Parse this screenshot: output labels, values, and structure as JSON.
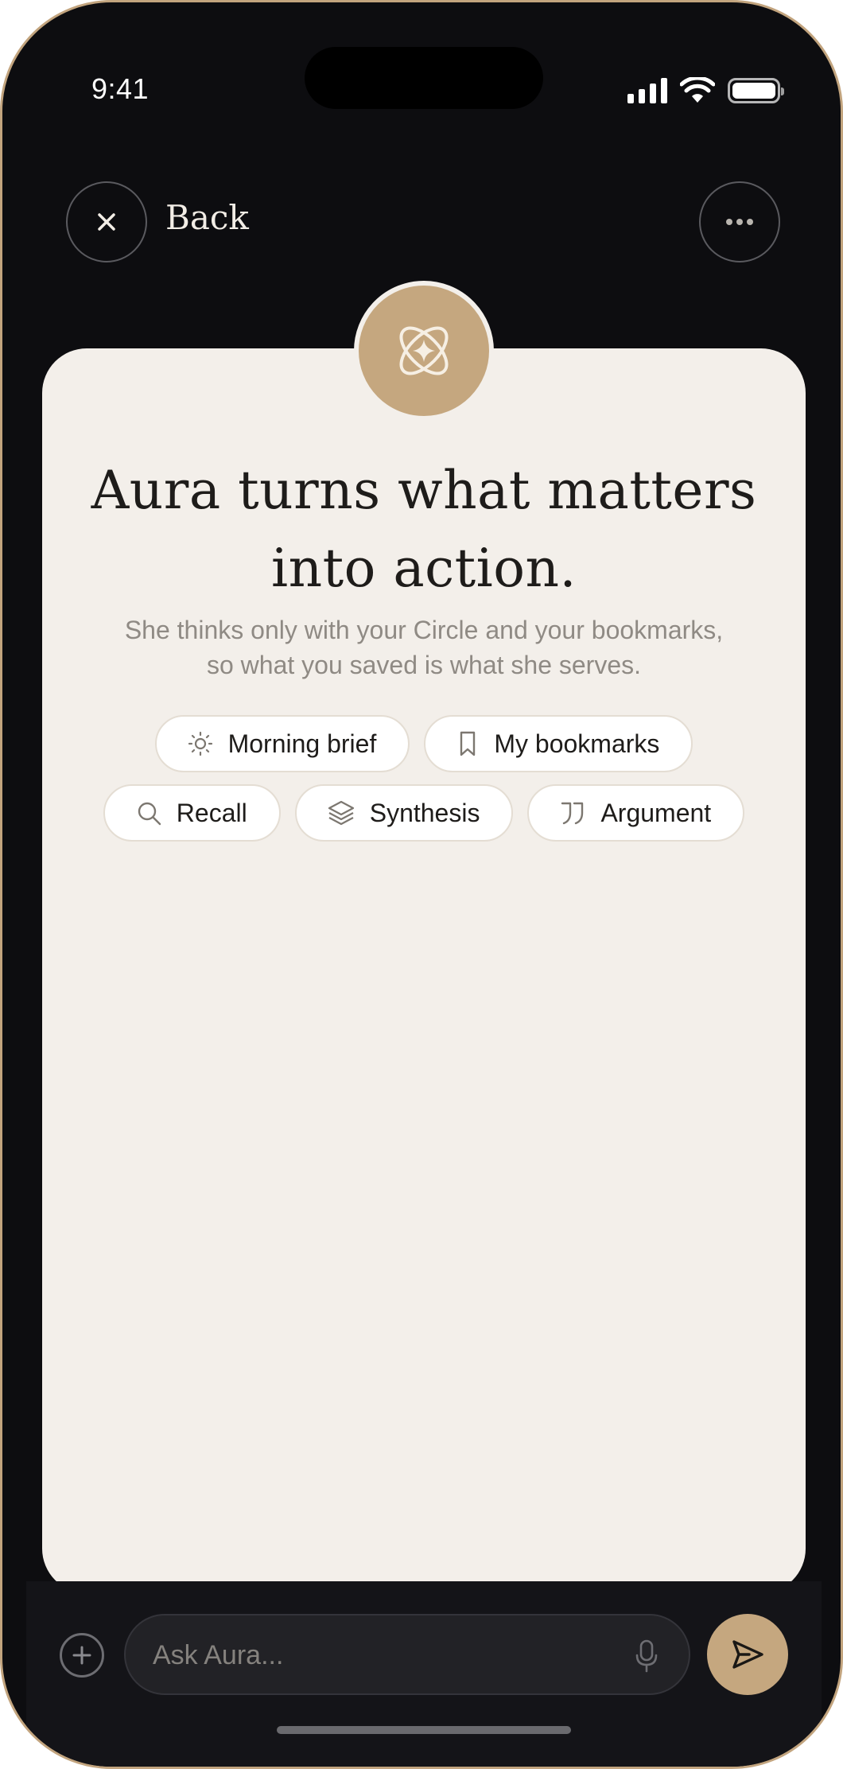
{
  "status_bar": {
    "time": "9:41"
  },
  "nav": {
    "back_label": "Back",
    "close_icon": "close-icon",
    "more_icon": "more-horizontal-icon"
  },
  "hero": {
    "avatar_icon": "atom-sparkle-icon",
    "headline": "Aura turns what matters into action.",
    "subtitle_line1": "She thinks only with your Circle and your bookmarks,",
    "subtitle_line2": "so what you saved is what she serves."
  },
  "chips": [
    {
      "label": "Morning brief",
      "icon": "sun-icon"
    },
    {
      "label": "My bookmarks",
      "icon": "bookmark-icon"
    },
    {
      "label": "Recall",
      "icon": "search-icon"
    },
    {
      "label": "Synthesis",
      "icon": "layers-icon"
    },
    {
      "label": "Argument",
      "icon": "quote-icon"
    }
  ],
  "composer": {
    "placeholder": "Ask Aura...",
    "value": "",
    "add_icon": "plus-circle-icon",
    "mic_icon": "mic-icon",
    "send_icon": "send-icon"
  },
  "colors": {
    "background": "#0d0d10",
    "card": "#f3efea",
    "accent": "#c5a77f",
    "text_dark": "#1e1c1a",
    "text_muted": "#8f8a84"
  }
}
